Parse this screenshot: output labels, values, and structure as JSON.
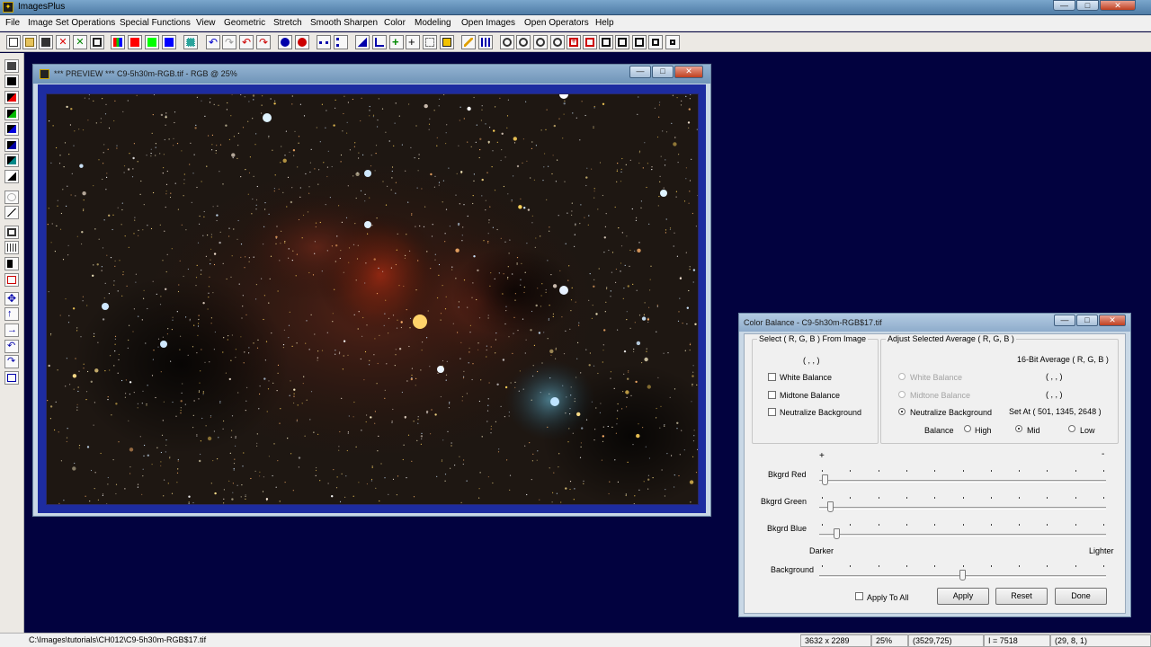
{
  "app": {
    "title": "ImagesPlus",
    "controls": {
      "minimize": "—",
      "maximize": "□",
      "close": "✕"
    }
  },
  "menu": {
    "items": [
      "File",
      "Image Set Operations",
      "Special Functions",
      "View",
      "Geometric",
      "Stretch",
      "Smooth Sharpen",
      "Color",
      "Modeling",
      "Open Images",
      "Open Operators",
      "Help"
    ]
  },
  "toolbar": {
    "icons": [
      "new-document-icon",
      "open-folder-icon",
      "save-icon",
      "close-red-x-icon",
      "close-green-x-icon",
      "copy-window-icon",
      "rgb-channels-icon",
      "red-channel-icon",
      "green-channel-icon",
      "blue-channel-icon",
      "grid-icon",
      "undo-icon",
      "redo-icon",
      "undo-red-icon",
      "redo-red-icon",
      "circle-marker-icon",
      "red-circle-icon",
      "dotted-line-icon",
      "dotted-point-icon",
      "histogram-icon",
      "levels-icon",
      "crosshair-icon",
      "plus-icon",
      "selection-icon",
      "stretch-icon",
      "pencil-icon",
      "table-icon",
      "zoom-in-icon",
      "zoom-out-icon",
      "zoom-fit-icon",
      "zoom-actual-icon",
      "add-frame-icon",
      "subtract-frame-icon",
      "square-1-icon",
      "square-2-icon",
      "square-3-icon",
      "square-4-icon",
      "square-5-icon"
    ]
  },
  "left_toolbar": {
    "icons": [
      "save-small-icon",
      "black-white-icon",
      "red-black-icon",
      "green-black-icon",
      "blue-black-icon",
      "blue-black-2-icon",
      "teal-black-icon",
      "black-corner-icon",
      "curves-icon",
      "diagonal-icon",
      "frame-icon",
      "bars-icon",
      "black-bar-icon",
      "magnifier-icon",
      "move-icon",
      "up-arrow-icon",
      "right-arrow-icon",
      "rotate-left-icon",
      "rotate-right-icon",
      "columns-icon"
    ]
  },
  "preview": {
    "title": "*** PREVIEW *** C9-5h30m-RGB.tif - RGB @ 25%",
    "controls": {
      "minimize": "—",
      "maximize": "□",
      "close": "✕"
    }
  },
  "dialog": {
    "title": "Color Balance - C9-5h30m-RGB$17.tif",
    "controls": {
      "minimize": "—",
      "maximize": "□",
      "close": "✕"
    },
    "select_group": {
      "label": "Select ( R, G, B ) From Image",
      "value": "( , , )",
      "white_balance": "White Balance",
      "midtone_balance": "Midtone Balance",
      "neutralize_background": "Neutralize Background"
    },
    "adjust_group": {
      "label": "Adjust Selected Average ( R, G, B )",
      "avg_header": "16-Bit Average ( R, G, B )",
      "white_balance": "White Balance",
      "white_value": "( , , )",
      "midtone_balance": "Midtone Balance",
      "midtone_value": "( , , )",
      "neutralize_background": "Neutralize Background",
      "set_at": "Set At ( 501, 1345, 2648 )",
      "balance_label": "Balance",
      "high": "High",
      "mid": "Mid",
      "low": "Low",
      "selected_balance": "Mid"
    },
    "sliders": {
      "plus": "+",
      "minus": "-",
      "red_label": "Bkgrd Red",
      "green_label": "Bkgrd Green",
      "blue_label": "Bkgrd Blue",
      "darker": "Darker",
      "lighter": "Lighter",
      "background_label": "Background",
      "red_level": 0.01,
      "green_level": 0.03,
      "blue_level": 0.05,
      "background_level": 0.5
    },
    "apply_to_all": "Apply To All",
    "buttons": {
      "apply": "Apply",
      "reset": "Reset",
      "done": "Done"
    }
  },
  "status": {
    "path": "C:\\Images\\tutorials\\CH012\\C9-5h30m-RGB$17.tif",
    "dimensions": "3632 x 2289",
    "zoom": "25%",
    "cursor": "(3529,725)",
    "intensity": "I = 7518",
    "rgb": "(29, 8, 1)"
  }
}
